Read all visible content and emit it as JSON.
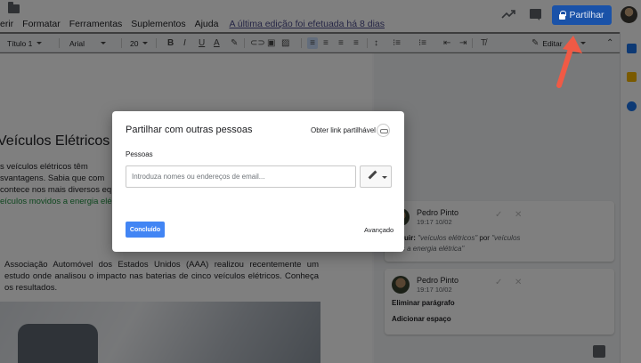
{
  "header": {
    "menu": [
      "erir",
      "Formatar",
      "Ferramentas",
      "Suplementos",
      "Ajuda"
    ],
    "last_edit": "A última edição foi efetuada há 8 dias",
    "share_label": "Partilhar"
  },
  "toolbar": {
    "style": "Título 1",
    "font": "Arial",
    "size": "20",
    "edit_mode": "Editar"
  },
  "document": {
    "title": "Veículos Elétricos",
    "lines": [
      "s  veículos  elétricos  têm",
      "svantagens. Sabia que com",
      "contece nos mais diversos eq",
      "eículos movidos a energia elé"
    ],
    "paragraph": "Associação Automóvel dos Estados Unidos (AAA) realizou recentemente um estudo onde analisou o impacto nas baterias de cinco veículos elétricos. Conheça os resultados."
  },
  "comments": [
    {
      "author": "Pedro Pinto",
      "date": "19:17 10/02",
      "action": "stituir:",
      "old": "\"veículos elétricos\"",
      "connector": "por",
      "new": "\"veículos",
      "new_cont": "dos a energia elétrica\""
    },
    {
      "author": "Pedro Pinto",
      "date": "19:17 10/02",
      "line1": "Eliminar parágrafo",
      "line2": "Adicionar espaço"
    }
  ],
  "dialog": {
    "title": "Partilhar com outras pessoas",
    "get_link": "Obter link partilhável",
    "people_label": "Pessoas",
    "input_placeholder": "Introduza nomes ou endereços de email...",
    "done_label": "Concluído",
    "advanced_label": "Avançado"
  },
  "colors": {
    "share_blue": "#1a73e8",
    "done_blue": "#4285f4",
    "arrow_red": "#f05a45"
  }
}
